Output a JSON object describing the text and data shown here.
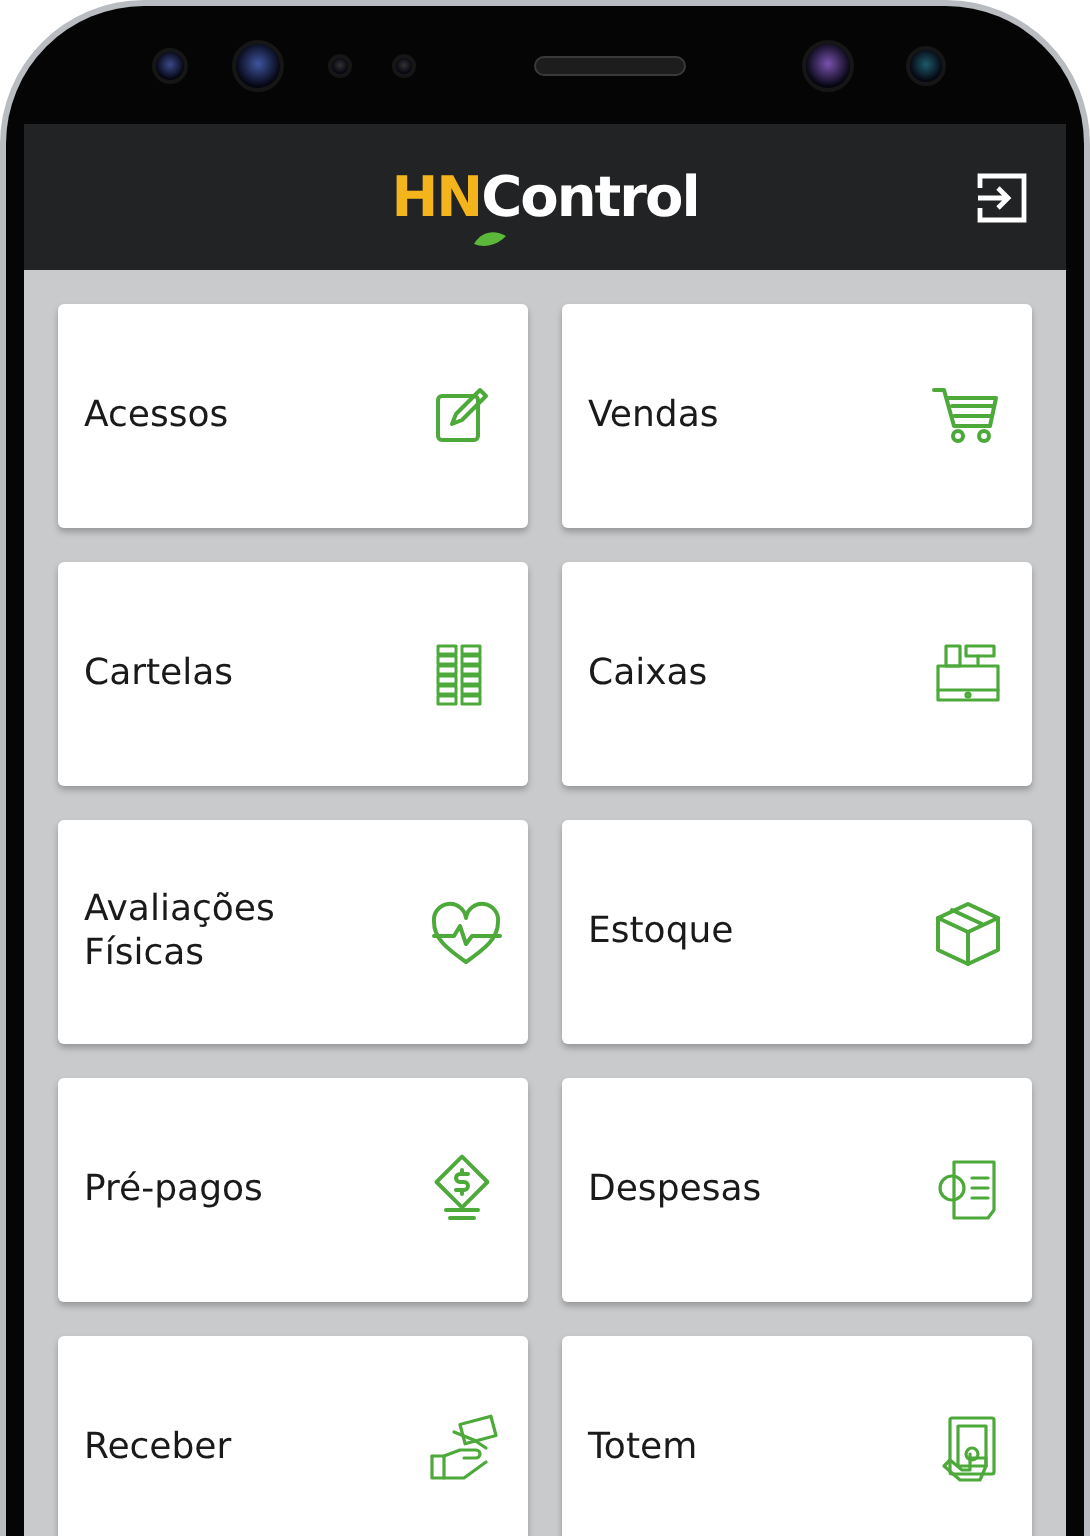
{
  "header": {
    "logo": {
      "part_1": "HN",
      "part_2": "Control"
    }
  },
  "tiles": [
    {
      "label": "Acessos"
    },
    {
      "label": "Vendas"
    },
    {
      "label": "Cartelas"
    },
    {
      "label": "Caixas"
    },
    {
      "label": "Avaliações Físicas"
    },
    {
      "label": "Estoque"
    },
    {
      "label": "Pré-pagos"
    },
    {
      "label": "Despesas"
    },
    {
      "label": "Receber"
    },
    {
      "label": "Totem"
    }
  ]
}
